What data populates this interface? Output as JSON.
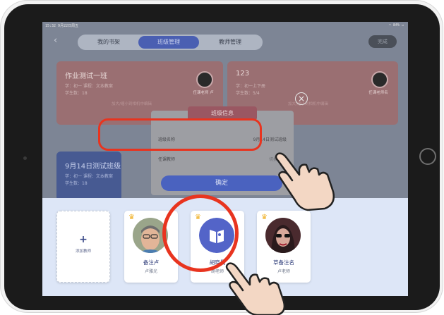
{
  "status_bar": {
    "time": "15:32  9月22日周五",
    "battery": "84%"
  },
  "tabs": [
    {
      "label": "我的书架",
      "active": false
    },
    {
      "label": "班级管理",
      "active": true
    },
    {
      "label": "教师管理",
      "active": false
    }
  ],
  "top_button": "完成",
  "cards": [
    {
      "title": "作业测试一班",
      "line1": "学：初一 课程：文本教案",
      "line2": "学生数：18",
      "hint": "加大/缩小到相机中编辑",
      "teacher": "任课老师  卢"
    },
    {
      "title": "123",
      "line1": "学：初一上下册",
      "line2": "学生数：5/4",
      "hint": "加大/缩小到相机中编辑",
      "teacher": "任课老师名"
    },
    {
      "title": "9月14日测试班级",
      "line1": "学：初一 课程：文本教案",
      "line2": "学生数：18"
    }
  ],
  "modal": {
    "title": "班级信息",
    "rows": [
      {
        "label": "班级名称",
        "value": "9月14日测试班级"
      },
      {
        "label": "任课教师",
        "value": "切换班 >"
      }
    ],
    "confirm": "确定"
  },
  "teachers": [
    {
      "name": "添加教师",
      "is_add": true
    },
    {
      "name": "备注卢",
      "sub": "卢雅光"
    },
    {
      "name": "胡晓晨",
      "sub": "胡老师"
    },
    {
      "name": "草备注名",
      "sub": "卢老师"
    }
  ]
}
